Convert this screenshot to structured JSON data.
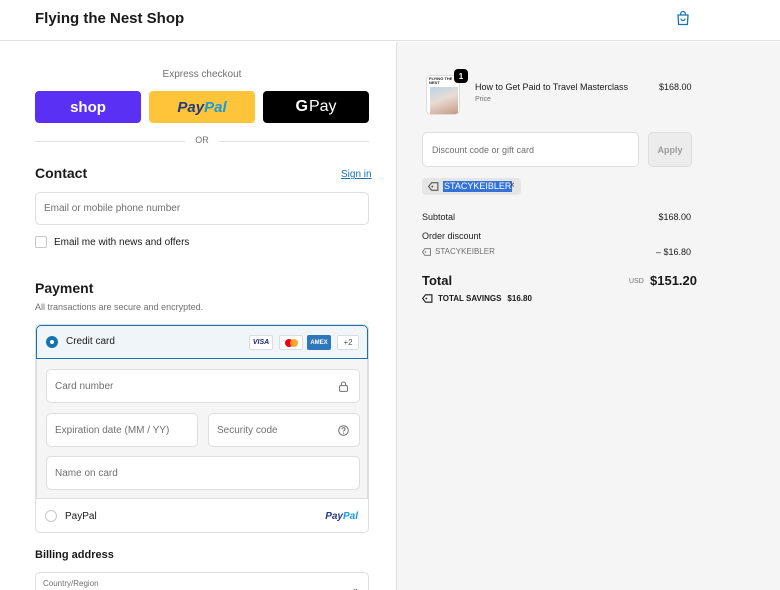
{
  "header": {
    "shop_name": "Flying the Nest Shop",
    "cart_icon": "shopping-bag-icon"
  },
  "express": {
    "label": "Express checkout",
    "shop_button": "shop",
    "paypal_button": {
      "part1": "Pay",
      "part2": "Pal"
    },
    "gpay_button": {
      "g": "G",
      "rest": "Pay"
    },
    "or_text": "OR"
  },
  "contact": {
    "title": "Contact",
    "sign_in": "Sign in",
    "email_placeholder": "Email or mobile phone number",
    "newsletter_label": "Email me with news and offers"
  },
  "payment": {
    "title": "Payment",
    "note": "All transactions are secure and encrypted.",
    "credit_card_label": "Credit card",
    "card_logos": {
      "visa": "VISA",
      "amex": "AMEX",
      "more": "+2"
    },
    "card_number_placeholder": "Card number",
    "expiration_placeholder": "Expiration date (MM / YY)",
    "security_code_placeholder": "Security code",
    "name_on_card_placeholder": "Name on card",
    "paypal_label": "PayPal",
    "paypal_logo": {
      "part1": "Pay",
      "part2": "Pal"
    }
  },
  "billing": {
    "title": "Billing address",
    "country_label": "Country/Region"
  },
  "order": {
    "product": {
      "thumb_text": "FLYING THE NEST",
      "quantity": "1",
      "name": "How to Get Paid to Travel Masterclass",
      "subtitle": "Price",
      "price": "$168.00"
    },
    "discount_placeholder": "Discount code or gift card",
    "apply_label": "Apply",
    "applied_code": "STACYKEIBLER",
    "remove_symbol": "×",
    "subtotal_label": "Subtotal",
    "subtotal_value": "$168.00",
    "order_discount_label": "Order discount",
    "discount_code": "STACYKEIBLER",
    "discount_value": "– $16.80",
    "total_label": "Total",
    "currency": "USD",
    "total_value": "$151.20",
    "savings_label": "TOTAL SAVINGS",
    "savings_value": "$16.80"
  },
  "colors": {
    "shop_purple": "#5a31f4",
    "paypal_yellow": "#ffc439",
    "link_blue": "#1773b0"
  }
}
